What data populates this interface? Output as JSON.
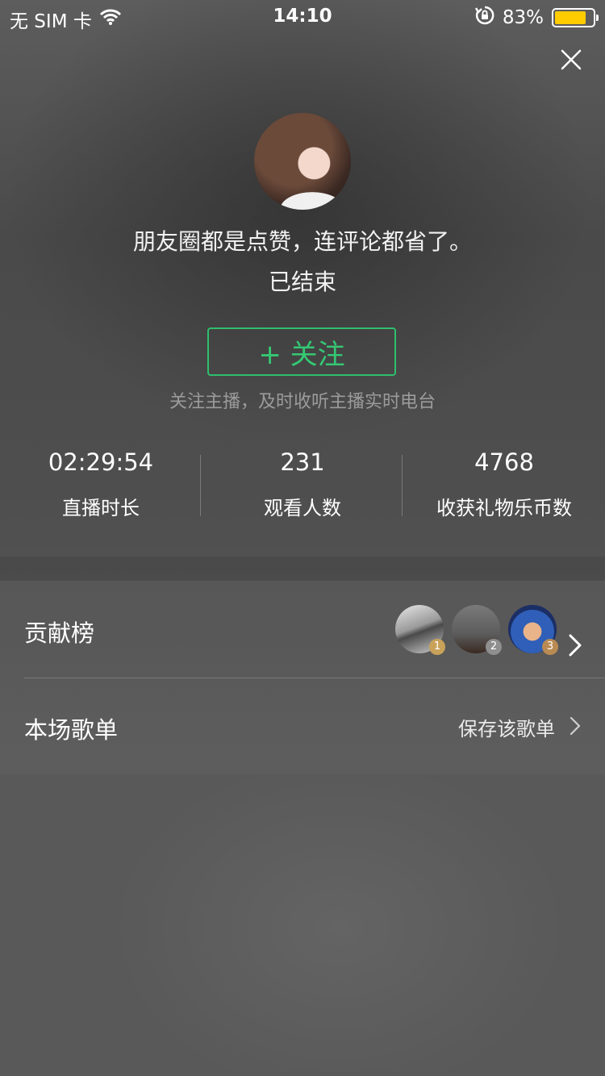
{
  "status_bar": {
    "carrier": "无 SIM 卡",
    "time": "14:10",
    "battery_percent": "83%",
    "battery_level": 0.83,
    "battery_color": "#ffcc00",
    "icons": [
      "wifi-icon",
      "rotation-lock-icon",
      "battery-icon"
    ]
  },
  "header": {
    "close_icon": "close-icon",
    "title": "朋友圈都是点赞，连评论都省了。",
    "status": "已结束"
  },
  "follow": {
    "button_label": "+ 关注",
    "button_color": "#2fbf6d",
    "hint": "关注主播，及时收听主播实时电台"
  },
  "stats": [
    {
      "value": "02:29:54",
      "label": "直播时长"
    },
    {
      "value": "231",
      "label": "观看人数"
    },
    {
      "value": "4768",
      "label": "收获礼物乐币数"
    }
  ],
  "contribution": {
    "label": "贡献榜",
    "ranks": [
      {
        "rank": "1",
        "badge_color": "#c9a25a"
      },
      {
        "rank": "2",
        "badge_color": "#8f8f8f"
      },
      {
        "rank": "3",
        "badge_color": "#b98b52"
      }
    ]
  },
  "playlist": {
    "label": "本场歌单",
    "action": "保存该歌单"
  }
}
